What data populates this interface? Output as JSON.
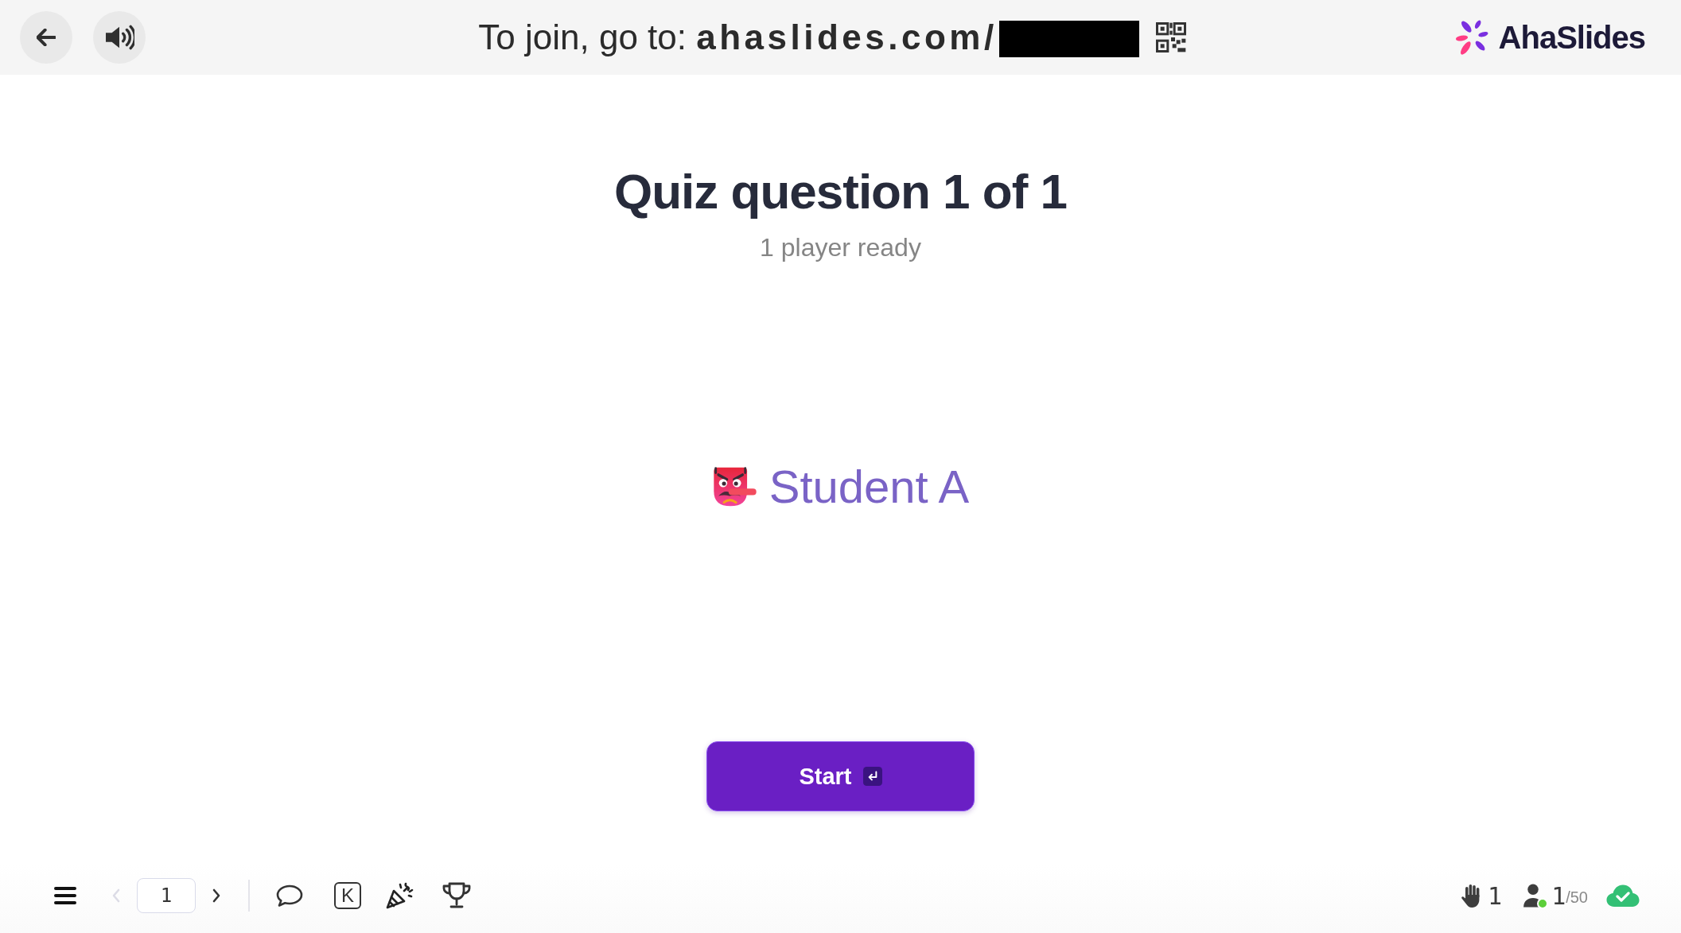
{
  "top_bar": {
    "join": {
      "text": "To join, go to: **ahaslides.com/**",
      "code_redacted": true
    },
    "brand": "AhaSlides"
  },
  "heading": {
    "title": "Quiz question 1 of 1",
    "subtitle": "1 player ready"
  },
  "players": [
    {
      "name": "Student A"
    }
  ],
  "start_button": {
    "label": "Start"
  },
  "toolbar": {
    "prev": {
      "disabled": true
    },
    "page": "1",
    "next": {
      "disabled": false
    },
    "shortcut_key": "K"
  },
  "status": {
    "raised_hands": "1",
    "participants": "1",
    "participant_limit": "/50",
    "online": true,
    "saved": true
  }
}
